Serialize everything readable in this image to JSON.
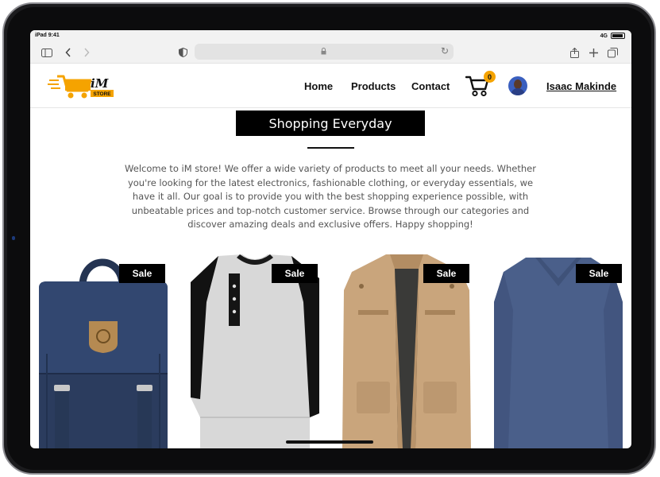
{
  "status_bar": {
    "device": "iPad",
    "time": "9:41",
    "network": "4G"
  },
  "browser": {
    "sidebar_icon": "sidebar-icon",
    "back_icon": "chevron-left-icon",
    "forward_icon": "chevron-right-icon",
    "privacy_icon": "shield-icon",
    "lock_icon": "lock-icon",
    "reload_icon": "reload-icon",
    "share_icon": "share-icon",
    "new_tab_icon": "plus-icon",
    "tabs_icon": "tabs-icon"
  },
  "header": {
    "logo_text": "iM",
    "logo_sub": "STORE",
    "nav": [
      {
        "label": "Home"
      },
      {
        "label": "Products"
      },
      {
        "label": "Contact"
      }
    ],
    "cart_count": "0",
    "user_name": "Isaac Makinde"
  },
  "hero": {
    "title": "Shopping Everyday",
    "description": "Welcome to iM store! We offer a wide variety of products to meet all your needs. Whether you're looking for the latest electronics, fashionable clothing, or everyday essentials, we have it all. Our goal is to provide you with the best shopping experience possible, with unbeatable prices and top-notch customer service. Browse through our categories and discover amazing deals and exclusive offers. Happy shopping!"
  },
  "products": [
    {
      "badge": "Sale",
      "item": "navy-backpack"
    },
    {
      "badge": "Sale",
      "item": "raglan-henley-shirt"
    },
    {
      "badge": "Sale",
      "item": "khaki-jacket"
    },
    {
      "badge": "Sale",
      "item": "blue-vneck-shirt"
    }
  ],
  "colors": {
    "accent": "#f5a300",
    "badge_bg": "#000000",
    "text": "#111111",
    "muted_text": "#555555"
  }
}
